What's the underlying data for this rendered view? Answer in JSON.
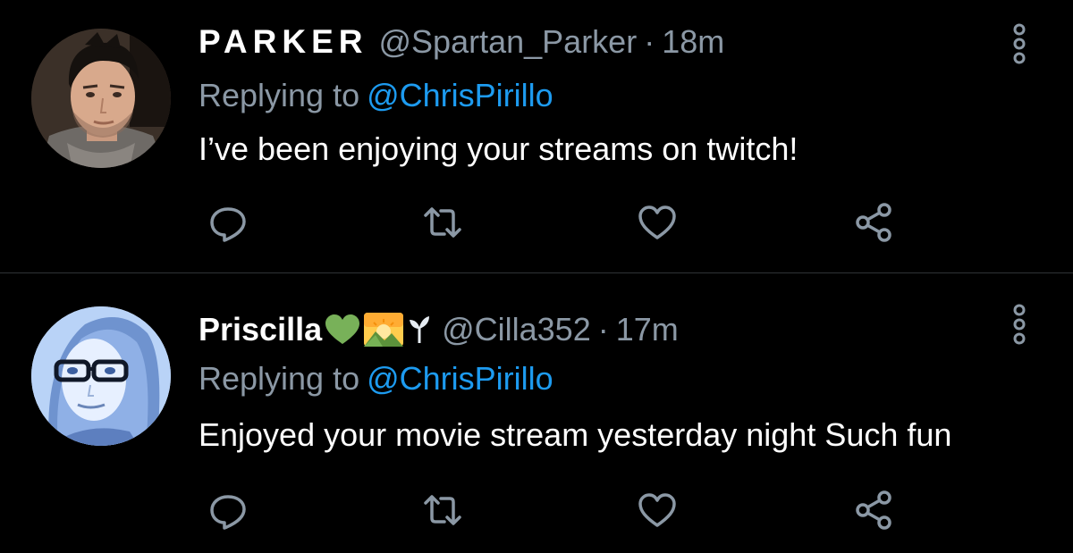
{
  "colors": {
    "background": "#000000",
    "text_primary": "#ffffff",
    "text_secondary": "#8b98a5",
    "link": "#1d9bf0",
    "divider": "#2f3336"
  },
  "tweets": [
    {
      "display_name": "PARKER",
      "handle": "@Spartan_Parker",
      "separator": "·",
      "time": "18m",
      "reply_prefix": "Replying to",
      "reply_to": "@ChrisPirillo",
      "text": "I’ve been enjoying your streams on twitch!",
      "avatar_icon": "user-photo-parker",
      "actions": [
        "reply-icon",
        "retweet-icon",
        "like-icon",
        "share-icon"
      ],
      "more_icon": "more-vertical-icon"
    },
    {
      "display_name": "Priscilla",
      "name_emojis": [
        "green-heart-emoji",
        "sunrise-over-mountains-emoji",
        "seedling-emoji"
      ],
      "handle": "@Cilla352",
      "separator": "·",
      "time": "17m",
      "reply_prefix": "Replying to",
      "reply_to": "@ChrisPirillo",
      "text": "Enjoyed your movie stream yesterday night Such fun",
      "avatar_icon": "user-photo-priscilla",
      "actions": [
        "reply-icon",
        "retweet-icon",
        "like-icon",
        "share-icon"
      ],
      "more_icon": "more-vertical-icon"
    }
  ]
}
